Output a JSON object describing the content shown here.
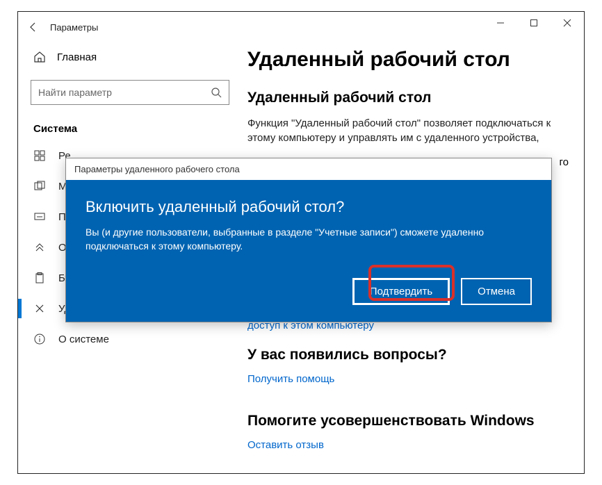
{
  "window": {
    "title": "Параметры",
    "minimize": "—",
    "maximize": "□",
    "close": "×"
  },
  "sidebar": {
    "home_label": "Главная",
    "search_placeholder": "Найти параметр",
    "section_header": "Система",
    "items": [
      {
        "label": "Ре",
        "icon": "apps"
      },
      {
        "label": "М",
        "icon": "multitask"
      },
      {
        "label": "П",
        "icon": "project"
      },
      {
        "label": "О",
        "icon": "shared"
      },
      {
        "label": "Буфер обмена",
        "icon": "clipboard"
      },
      {
        "label": "Удаленный рабочий стол",
        "icon": "remote",
        "active": true
      },
      {
        "label": "О системе",
        "icon": "info"
      }
    ]
  },
  "main": {
    "page_title": "Удаленный рабочий стол",
    "section1_title": "Удаленный рабочий стол",
    "section1_body": "Функция \"Удаленный рабочий стол\" позволяет подключаться к этому компьютеру и управлять им с удаленного устройства,",
    "body_trail": "го",
    "link_access": "доступ к этом компьютеру",
    "section2_title": "У вас появились вопросы?",
    "help_link": "Получить помощь",
    "section3_title": "Помогите усовершенствовать Windows",
    "feedback_link": "Оставить отзыв"
  },
  "dialog": {
    "title": "Параметры удаленного рабочего стола",
    "heading": "Включить удаленный рабочий стол?",
    "body": "Вы (и другие пользователи, выбранные в разделе \"Учетные записи\") сможете удаленно подключаться к этому компьютеру.",
    "confirm_label": "Подтвердить",
    "cancel_label": "Отмена"
  }
}
